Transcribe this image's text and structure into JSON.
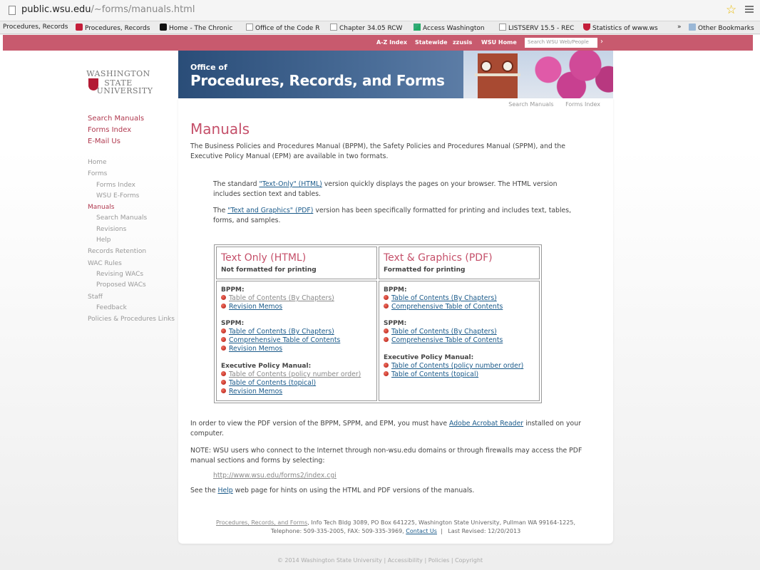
{
  "browser": {
    "url_host": "public.wsu.edu",
    "url_path": "/~forms/manuals.html",
    "bookmarks": [
      "Procedures, Records",
      "Procedures, Records",
      "Home - The Chronic",
      "Office of the Code R",
      "Chapter 34.05 RCW",
      "Access Washington",
      "LISTSERV 15.5 - REC",
      "Statistics of www.ws"
    ],
    "overflow": "»",
    "other_bookmarks": "Other Bookmarks"
  },
  "topbar": {
    "az": "A-Z Index",
    "statewide": "Statewide",
    "zzusis": "zzusis",
    "home": "WSU Home",
    "search_placeholder": "Search WSU Web/People"
  },
  "logo": {
    "line1": "WASHINGTON STATE",
    "line2": "UNIVERSITY"
  },
  "banner": {
    "line1": "Office of",
    "line2": "Procedures, Records, and Forms"
  },
  "subnav": {
    "search": "Search Manuals",
    "forms": "Forms Index"
  },
  "leftnav": {
    "top": [
      "Search Manuals",
      "Forms Index",
      "E-Mail Us"
    ],
    "items": [
      {
        "label": "Home",
        "sub": false,
        "active": false
      },
      {
        "label": "Forms",
        "sub": false,
        "active": false
      },
      {
        "label": "Forms Index",
        "sub": true,
        "active": false
      },
      {
        "label": "WSU E-Forms",
        "sub": true,
        "active": false
      },
      {
        "label": "Manuals",
        "sub": false,
        "active": true
      },
      {
        "label": "Search Manuals",
        "sub": true,
        "active": false
      },
      {
        "label": "Revisions",
        "sub": true,
        "active": false
      },
      {
        "label": "Help",
        "sub": true,
        "active": false
      },
      {
        "label": "Records Retention",
        "sub": false,
        "active": false
      },
      {
        "label": "WAC Rules",
        "sub": false,
        "active": false
      },
      {
        "label": "Revising WACs",
        "sub": true,
        "active": false
      },
      {
        "label": "Proposed WACs",
        "sub": true,
        "active": false
      },
      {
        "label": "Staff",
        "sub": false,
        "active": false
      },
      {
        "label": "Feedback",
        "sub": true,
        "active": false
      },
      {
        "label": "Policies & Procedures Links",
        "sub": false,
        "active": false
      }
    ]
  },
  "main": {
    "title": "Manuals",
    "intro": "The Business Policies and Procedures Manual (BPPM), the Safety Policies and Procedures Manual (SPPM), and the Executive Policy Manual (EPM) are available in two formats.",
    "p1_pre": "The standard ",
    "p1_link": "\"Text-Only\" (HTML)",
    "p1_post": " version quickly displays the pages on your browser. The HTML version includes section text and tables.",
    "p2_pre": "The ",
    "p2_link": "\"Text and Graphics\" (PDF)",
    "p2_post": " version has been specifically formatted for printing and includes text, tables, forms, and samples.",
    "acrobat_pre": "In order to view the PDF version of the BPPM, SPPM, and EPM, you must have ",
    "acrobat_link": "Adobe Acrobat Reader",
    "acrobat_post": " installed on your computer.",
    "note": "NOTE: WSU users who connect to the Internet through non-wsu.edu domains or through firewalls may access the PDF manual sections and forms by selecting:",
    "note_link": "http://www.wsu.edu/forms2/index.cgi",
    "help_pre": "See the ",
    "help_link": "Help",
    "help_post": " web page for hints on using the HTML and PDF versions of the manuals."
  },
  "table": {
    "html": {
      "title": "Text Only (HTML)",
      "subtitle": "Not formatted for printing",
      "bppm_label": "BPPM:",
      "bppm": [
        "Table of Contents (By Chapters)",
        "Revision Memos"
      ],
      "sppm_label": "SPPM:",
      "sppm": [
        "Table of Contents (By Chapters)",
        "Comprehensive Table of Contents",
        "Revision Memos"
      ],
      "epm_label": "Executive Policy Manual:",
      "epm": [
        "Table of Contents (policy number order)",
        "Table of Contents (topical)",
        "Revision Memos"
      ]
    },
    "pdf": {
      "title": "Text & Graphics (PDF)",
      "subtitle": "Formatted for printing",
      "bppm_label": "BPPM:",
      "bppm": [
        "Table of Contents (By Chapters)",
        "Comprehensive Table of Contents"
      ],
      "sppm_label": "SPPM:",
      "sppm": [
        "Table of Contents (By Chapters)",
        "Comprehensive Table of Contents"
      ],
      "epm_label": "Executive Policy Manual:",
      "epm": [
        "Table of Contents (policy number order)",
        "Table of Contents (topical)"
      ]
    }
  },
  "footer": {
    "office_link": "Procedures, Records, and Forms",
    "address": ", Info Tech Bldg 3089, PO Box 641225, Washington State University, Pullman WA 99164-1225,",
    "phone": "Telephone: 509-335-2005, FAX: 509-335-3969, ",
    "contact_link": "Contact Us",
    "revised": "  |   Last Revised: 12/20/2013",
    "copyright": "© 2014 Washington State University",
    "sep": " | ",
    "accessibility": "Accessibility",
    "policies": "Policies",
    "copyright_link": "Copyright"
  },
  "colors": {
    "crimson_bar": "#c85a6e",
    "heading": "#c5506a",
    "link": "#1a5a8a"
  }
}
